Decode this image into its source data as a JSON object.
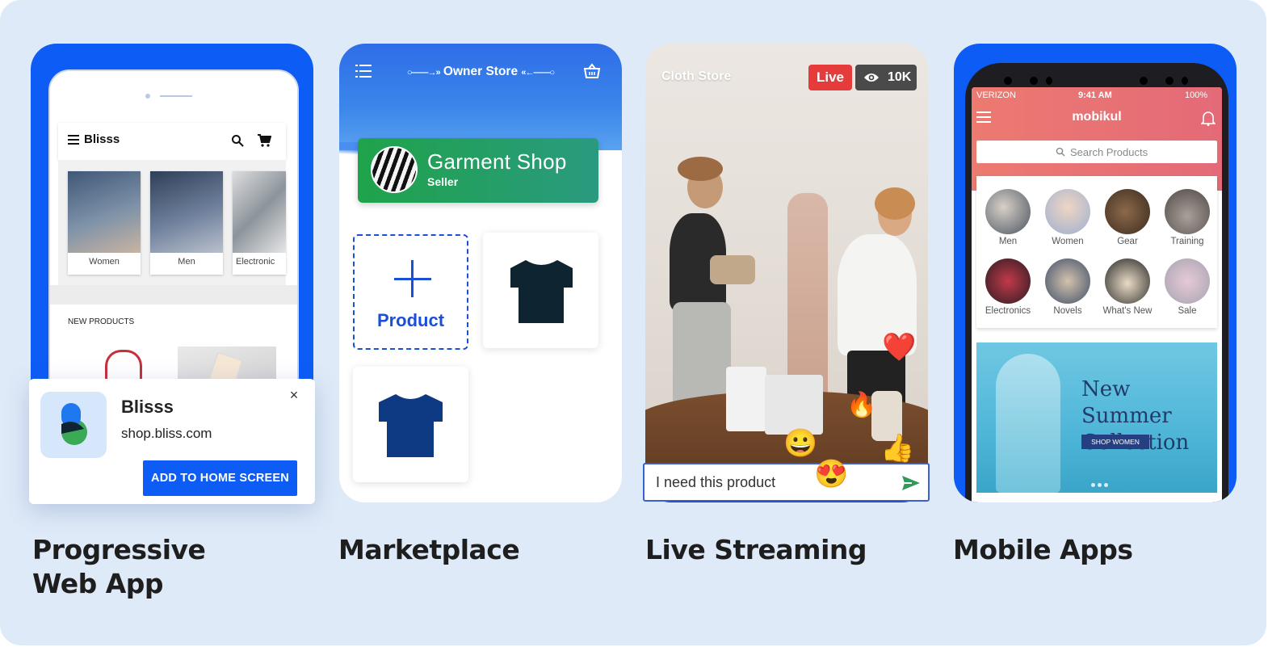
{
  "pwa": {
    "caption": "Progressive Web App",
    "brand": "Blisss",
    "categories": [
      {
        "label": "Women",
        "color": "#4f6c8e"
      },
      {
        "label": "Men",
        "color": "#5d718f"
      },
      {
        "label": "Electronic",
        "color": "#8f9aa6"
      }
    ],
    "section_title": "NEW PRODUCTS",
    "install": {
      "app_name": "Blisss",
      "url": "shop.bliss.com",
      "button": "ADD TO HOME SCREEN",
      "close": "×"
    },
    "accent": "#0c5cf5"
  },
  "marketplace": {
    "caption": "Marketplace",
    "store_title": "Owner Store",
    "shop_name": "Garment Shop",
    "shop_role": "Seller",
    "add_label": "Product",
    "products": [
      {
        "icon": "tshirt-dark-icon",
        "color": "#0f2431"
      },
      {
        "icon": "tshirt-navy-icon",
        "color": "#0d3a82"
      }
    ]
  },
  "live": {
    "caption": "Live Streaming",
    "store_name": "Cloth Store",
    "live_badge": "Live",
    "viewers": "10K",
    "message": "I need this product",
    "emojis": [
      "❤️",
      "🔥",
      "😀",
      "😍",
      "👍"
    ]
  },
  "mobile": {
    "caption": "Mobile Apps",
    "carrier": "VERIZON",
    "time": "9:41 AM",
    "battery": "100%",
    "app_title": "mobikul",
    "search_placeholder": "Search Products",
    "categories": [
      {
        "label": "Men",
        "color": "#7e8c99"
      },
      {
        "label": "Women",
        "color": "#9bb0cf"
      },
      {
        "label": "Gear",
        "color": "#6b4a35"
      },
      {
        "label": "Training",
        "color": "#7d7472"
      },
      {
        "label": "Electronics",
        "color": "#8a1e2c"
      },
      {
        "label": "Novels",
        "color": "#5f6f86"
      },
      {
        "label": "What's New",
        "color": "#b9a78f"
      },
      {
        "label": "Sale",
        "color": "#c9b6c0"
      }
    ],
    "banner_title": "New Summer Collection",
    "banner_button": "SHOP WOMEN"
  }
}
